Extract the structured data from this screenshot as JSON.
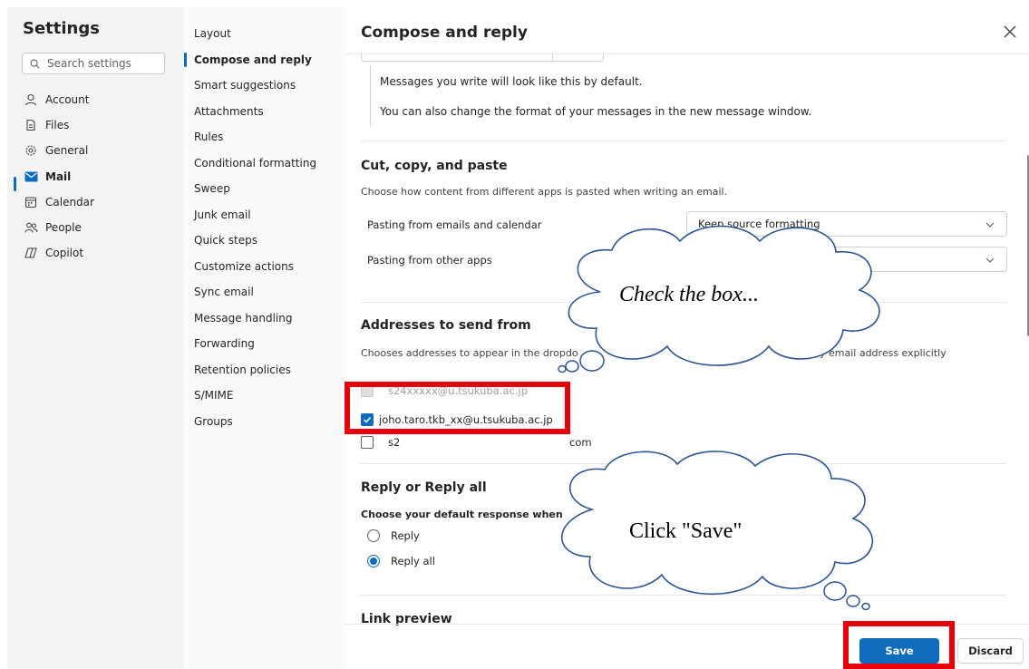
{
  "sidebar": {
    "title": "Settings",
    "search_placeholder": "Search settings",
    "items": [
      {
        "label": "Account"
      },
      {
        "label": "Files"
      },
      {
        "label": "General"
      },
      {
        "label": "Mail"
      },
      {
        "label": "Calendar"
      },
      {
        "label": "People"
      },
      {
        "label": "Copilot"
      }
    ],
    "active_item": "Mail"
  },
  "mail_menu": {
    "items": [
      {
        "label": "Layout"
      },
      {
        "label": "Compose and reply"
      },
      {
        "label": "Smart suggestions"
      },
      {
        "label": "Attachments"
      },
      {
        "label": "Rules"
      },
      {
        "label": "Conditional formatting"
      },
      {
        "label": "Sweep"
      },
      {
        "label": "Junk email"
      },
      {
        "label": "Quick steps"
      },
      {
        "label": "Customize actions"
      },
      {
        "label": "Sync email"
      },
      {
        "label": "Message handling"
      },
      {
        "label": "Forwarding"
      },
      {
        "label": "Retention policies"
      },
      {
        "label": "S/MIME"
      },
      {
        "label": "Groups"
      }
    ],
    "active_item": "Compose and reply"
  },
  "main": {
    "title": "Compose and reply",
    "format_note_1": "Messages you write will look like this by default.",
    "format_note_2": "You can also change the format of your messages in the new message window.",
    "cut_copy_paste": {
      "title": "Cut, copy, and paste",
      "description": "Choose how content from different apps is pasted when writing an email.",
      "row1_label": "Pasting from emails and calendar",
      "row1_value": "Keep source formatting",
      "row2_label": "Pasting from other apps",
      "row2_value": ""
    },
    "addresses": {
      "title": "Addresses to send from",
      "description_start": "Chooses addresses to appear in the dropdo",
      "description_end": "y email address explicitly",
      "address_1": "s24xxxxx@u.tsukuba.ac.jp",
      "address_2": "joho.taro.tkb_xx@u.tsukuba.ac.jp",
      "address_3_start": "s2",
      "address_3_end": "com"
    },
    "reply": {
      "title": "Reply or Reply all",
      "description": "Choose your default response when",
      "option_reply": "Reply",
      "option_reply_all": "Reply all",
      "selected": "Reply all"
    },
    "link_preview_title": "Link preview"
  },
  "footer": {
    "save_label": "Save",
    "discard_label": "Discard"
  },
  "annotations": {
    "cloud_1_text": "Check the box...",
    "cloud_2_text": "Click \"Save\"",
    "highlight_color": "#e8000b"
  },
  "colors": {
    "accent": "#0f6cbd",
    "sidebar_bg": "#f3f3f3",
    "submenu_bg": "#fafafa"
  }
}
